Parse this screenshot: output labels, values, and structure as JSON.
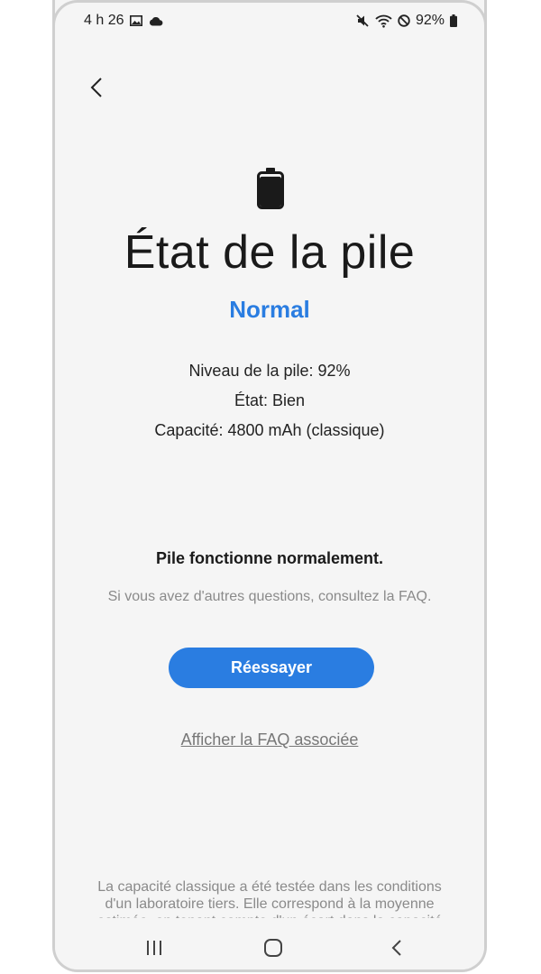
{
  "status_bar": {
    "time": "4 h 26",
    "battery_percent": "92%",
    "icons": [
      "image-icon",
      "cloud-icon",
      "mute-icon",
      "wifi-icon",
      "block-icon",
      "battery-icon"
    ]
  },
  "header": {
    "back_icon": "chevron-left-icon"
  },
  "battery_graphic": {
    "level": 0.92
  },
  "title": "État de la pile",
  "status_word": "Normal",
  "details": {
    "level": "Niveau de la pile: 92%",
    "state": "État: Bien",
    "capacity": "Capacité: 4800 mAh (classique)"
  },
  "message": "Pile fonctionne normalement.",
  "faq_hint": "Si vous avez d'autres questions, consultez la FAQ.",
  "retry_label": "Réessayer",
  "faq_link": "Afficher la FAQ associée",
  "footnote": "La capacité classique a été testée dans les conditions d'un laboratoire tiers. Elle correspond à la moyenne estimée, en tenant compte d'un écart dans la capacité",
  "nav": {
    "icons": [
      "recents-icon",
      "home-icon",
      "back-icon"
    ]
  },
  "colors": {
    "accent": "#2a7de1",
    "background": "#f5f5f5"
  }
}
